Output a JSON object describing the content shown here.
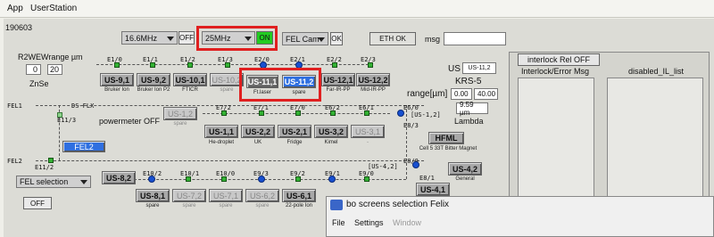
{
  "menu": {
    "app": "App",
    "user_station": "UserStation"
  },
  "header": {
    "id": "190603",
    "freq1": "16.6MHz",
    "off_label": "OFF",
    "freq2": "25MHz",
    "on_label": "ON",
    "fel_cam": "FEL Cam",
    "ok_label": "OK",
    "eth_ok": "ETH OK",
    "msg_label": "msg",
    "msg_value": ""
  },
  "left": {
    "r2we_label": "R2WEWrange µm",
    "range_min": "0",
    "range_max": "20",
    "crystal": "ZnSe",
    "fel1": "FEL1",
    "fel2": "FEL2",
    "ds_flx": "DS-FLX",
    "powermeter": "powermeter OFF",
    "fel2_button": "FEL2",
    "fel_selection": "FEL selection",
    "off_button": "OFF",
    "tags": {
      "e11_3": "E11/3",
      "e11_2": "E11/2",
      "e1_0": "E1/0",
      "e1_1": "E1/1",
      "e1_2": "E1/2",
      "e1_3": "E1/3",
      "e2_0": "E2/0",
      "e2_1": "E2/1",
      "e2_2": "E2/2",
      "e2_3": "E2/3",
      "e7_2": "E7/2",
      "e7_1": "E7/1",
      "e7_0": "E7/0",
      "e6_2": "E6/2",
      "e6_1": "E6/1",
      "e6_0": "E6/0",
      "e6_0_tag": "[US-1,2]",
      "e8_3": "E8/3",
      "e10_2": "E10/2",
      "e10_1": "E10/1",
      "e10_0": "E10/0",
      "e9_3": "E9/3",
      "e9_2": "E9/2",
      "e9_1": "E9/1",
      "e9_0": "E9/0",
      "e8_0": "E8/0",
      "e8_1": "E8/1",
      "e8_tag": "[US-4,2]"
    },
    "row1": [
      {
        "label": "US-9,1",
        "sub": "Bruker Ion"
      },
      {
        "label": "US-9,2",
        "sub": "Bruker Ion P2"
      },
      {
        "label": "US-10,1",
        "sub": "FTICR"
      },
      {
        "label": "US-10,2",
        "sub": "spare"
      },
      {
        "label": "US-11,1",
        "sub": "Ft.laser"
      },
      {
        "label": "US-11,2",
        "sub": "spare"
      },
      {
        "label": "US-12,1",
        "sub": "Far-IR-PP"
      },
      {
        "label": "US-12,2",
        "sub": "Mid-IR-PP"
      }
    ],
    "row2": [
      {
        "label": "US-1,2",
        "sub": "spare"
      },
      {
        "label": "US-1,1",
        "sub": "He-droplet"
      },
      {
        "label": "US-2,2",
        "sub": "UK"
      },
      {
        "label": "US-2,1",
        "sub": "Fridge"
      },
      {
        "label": "US-3,2",
        "sub": "Kimel"
      },
      {
        "label": "US-3,1",
        "sub": "-"
      }
    ],
    "hfml": {
      "label": "HFML",
      "sub": "Cell 5 33T Bitter Magnet"
    },
    "row3": [
      {
        "label": "US-8,2",
        "sub": ""
      },
      {
        "label": "US-8,1",
        "sub": "spare"
      },
      {
        "label": "US-7,2",
        "sub": "spare"
      },
      {
        "label": "US-7,1",
        "sub": "spare"
      },
      {
        "label": "US-6,2",
        "sub": "spare"
      },
      {
        "label": "US-6,1",
        "sub": "22-pole Ion"
      }
    ],
    "us42": {
      "label": "US-4,2",
      "sub": "General"
    },
    "us41": {
      "label": "US-4,1",
      "sub": ""
    }
  },
  "us_panel": {
    "us_label": "US",
    "us_value": "US-11,2",
    "krs": "KRS-5",
    "range_label": "range[µm]",
    "range_min": "0.00",
    "range_max": "40.00",
    "wavelength": "9.59 µm",
    "lambda": "Lambda"
  },
  "right": {
    "interlock_rel": "interlock Rel OFF",
    "interlock_err": "Interlock/Error Msg",
    "disabled_il": "disabled_IL_list"
  },
  "popup": {
    "title": "bo screens selection Felix",
    "menu_file": "File",
    "menu_settings": "Settings",
    "menu_window": "Window"
  },
  "colors": {
    "highlight": "#e02020",
    "on_green": "#22cc22",
    "selected_blue": "#2f6fe0"
  }
}
